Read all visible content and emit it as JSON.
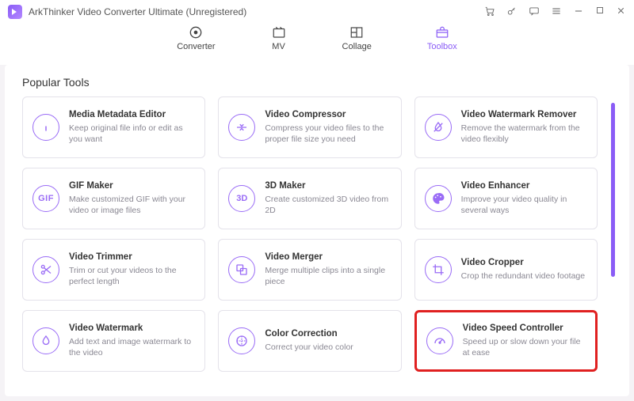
{
  "app": {
    "title": "ArkThinker Video Converter Ultimate (Unregistered)"
  },
  "tabs": {
    "converter": "Converter",
    "mv": "MV",
    "collage": "Collage",
    "toolbox": "Toolbox"
  },
  "section": {
    "title": "Popular Tools"
  },
  "tools": {
    "metadata": {
      "title": "Media Metadata Editor",
      "desc": "Keep original file info or edit as you want"
    },
    "compressor": {
      "title": "Video Compressor",
      "desc": "Compress your video files to the proper file size you need"
    },
    "watermark_remover": {
      "title": "Video Watermark Remover",
      "desc": "Remove the watermark from the video flexibly"
    },
    "gif": {
      "title": "GIF Maker",
      "desc": "Make customized GIF with your video or image files"
    },
    "three_d": {
      "title": "3D Maker",
      "desc": "Create customized 3D video from 2D"
    },
    "enhancer": {
      "title": "Video Enhancer",
      "desc": "Improve your video quality in several ways"
    },
    "trimmer": {
      "title": "Video Trimmer",
      "desc": "Trim or cut your videos to the perfect length"
    },
    "merger": {
      "title": "Video Merger",
      "desc": "Merge multiple clips into a single piece"
    },
    "cropper": {
      "title": "Video Cropper",
      "desc": "Crop the redundant video footage"
    },
    "watermark": {
      "title": "Video Watermark",
      "desc": "Add text and image watermark to the video"
    },
    "color": {
      "title": "Color Correction",
      "desc": "Correct your video color"
    },
    "speed": {
      "title": "Video Speed Controller",
      "desc": "Speed up or slow down your file at ease"
    }
  },
  "icon_labels": {
    "gif": "GIF",
    "three_d": "3D"
  },
  "colors": {
    "accent": "#8a5cf6",
    "highlight": "#e02020"
  }
}
